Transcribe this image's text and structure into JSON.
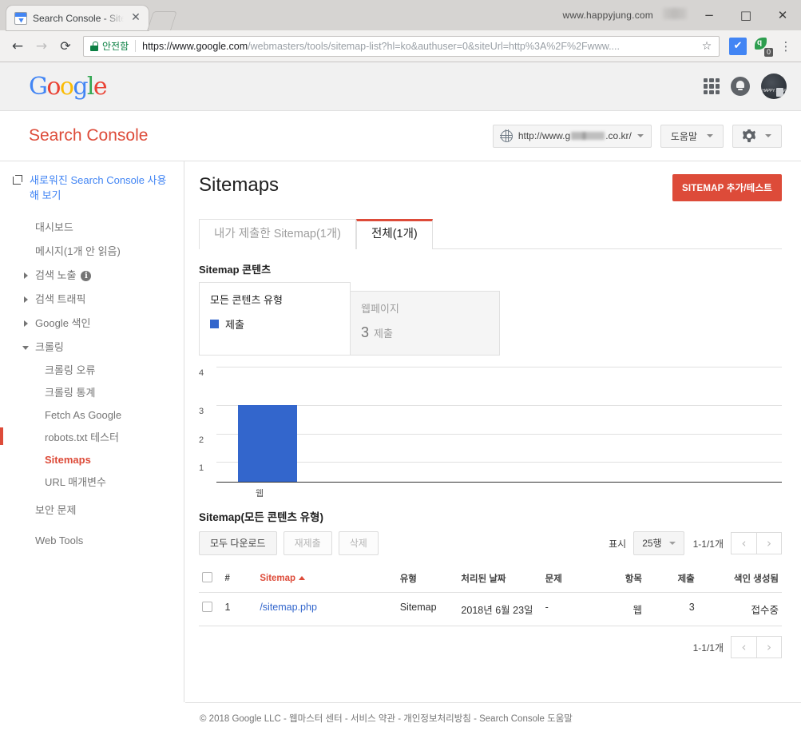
{
  "browser": {
    "tab_title": "Search Console - Sitema",
    "tab_close": "✕",
    "back": "←",
    "forward": "→",
    "reload": "⟳",
    "secure_label": "안전함",
    "url_bold": "https://www.google.com",
    "url_rest": "/webmasters/tools/sitemap-list?hl=ko&authuser=0&siteUrl=http%3A%2F%2Fwww....",
    "star": "☆",
    "ext_blue_glyph": "✔",
    "ext_green_glyph": "q",
    "ext_green_badge": "0",
    "menu": "⋮",
    "watermark": "www.happyjung.com",
    "minimize": "−",
    "maximize": "□",
    "close": "✕"
  },
  "gbar": {
    "logo": [
      "G",
      "o",
      "o",
      "g",
      "l",
      "e"
    ],
    "avatar_text": "HAPPY .COM"
  },
  "sc_header": {
    "title": "Search Console",
    "site_url_prefix": "http://www.g",
    "site_url_suffix": ".co.kr/",
    "help_label": "도움말"
  },
  "sidebar": {
    "promo": "새로워진 Search Console 사용해 보기",
    "items": [
      {
        "label": "대시보드",
        "type": "plain"
      },
      {
        "label": "메시지(1개 안 읽음)",
        "type": "plain"
      },
      {
        "label": "검색 노출",
        "type": "collapsed",
        "info": "i"
      },
      {
        "label": "검색 트래픽",
        "type": "collapsed"
      },
      {
        "label": "Google 색인",
        "type": "collapsed"
      },
      {
        "label": "크롤링",
        "type": "expanded"
      }
    ],
    "crawl_children": [
      {
        "label": "크롤링 오류",
        "active": false
      },
      {
        "label": "크롤링 통계",
        "active": false
      },
      {
        "label": "Fetch As Google",
        "active": false
      },
      {
        "label": "robots.txt 테스터",
        "active": false
      },
      {
        "label": "Sitemaps",
        "active": true
      },
      {
        "label": "URL 매개변수",
        "active": false
      }
    ],
    "footer_items": [
      {
        "label": "보안 문제"
      },
      {
        "label": "Web Tools"
      }
    ]
  },
  "main": {
    "page_title": "Sitemaps",
    "add_sitemap_button": "SITEMAP 추가/테스트",
    "tabs": [
      {
        "label": "내가 제출한 Sitemap(1개)",
        "active": false
      },
      {
        "label": "전체(1개)",
        "active": true
      }
    ],
    "content_section_label": "Sitemap 콘텐츠",
    "card_primary": {
      "title": "모든 콘텐츠 유형",
      "legend_label": "제출"
    },
    "card_secondary": {
      "title": "웹페이지",
      "value": "3",
      "unit": "제출"
    },
    "table_title": "Sitemap(모든 콘텐츠 유형)",
    "toolbar": {
      "download_all": "모두 다운로드",
      "resubmit": "재제출",
      "delete": "삭제",
      "display_label": "표시",
      "rows_value": "25행",
      "range": "1-1/1개",
      "prev": "‹",
      "next": "›"
    },
    "table": {
      "columns": [
        "#",
        "Sitemap",
        "유형",
        "처리된 날짜",
        "문제",
        "항목",
        "제출",
        "색인 생성됨"
      ],
      "sorted_column": "Sitemap",
      "rows": [
        {
          "index": "1",
          "sitemap": "/sitemap.php",
          "type": "Sitemap",
          "processed_date": "2018년 6월 23일",
          "issues": "-",
          "item_type": "웹",
          "submitted": "3",
          "indexed": "접수중"
        }
      ]
    },
    "bottom_range": "1-1/1개"
  },
  "chart_data": {
    "type": "bar",
    "categories": [
      "웹"
    ],
    "values": [
      3
    ],
    "title": "",
    "xlabel": "",
    "ylabel": "",
    "ylim": [
      0,
      4
    ],
    "yticks": [
      1,
      2,
      3,
      4
    ],
    "series": [
      {
        "name": "제출",
        "values": [
          3
        ],
        "color": "#3366cc"
      }
    ],
    "grid": true,
    "legend": "none"
  },
  "footer": {
    "text": "© 2018 Google LLC - 웹마스터 센터 - 서비스 약관 - 개인정보처리방침 - Search Console 도움말"
  },
  "colors": {
    "brand_red": "#dd4b39",
    "bar_blue": "#3366cc",
    "link_blue": "#3366cc",
    "secure_green": "#0b8043"
  }
}
